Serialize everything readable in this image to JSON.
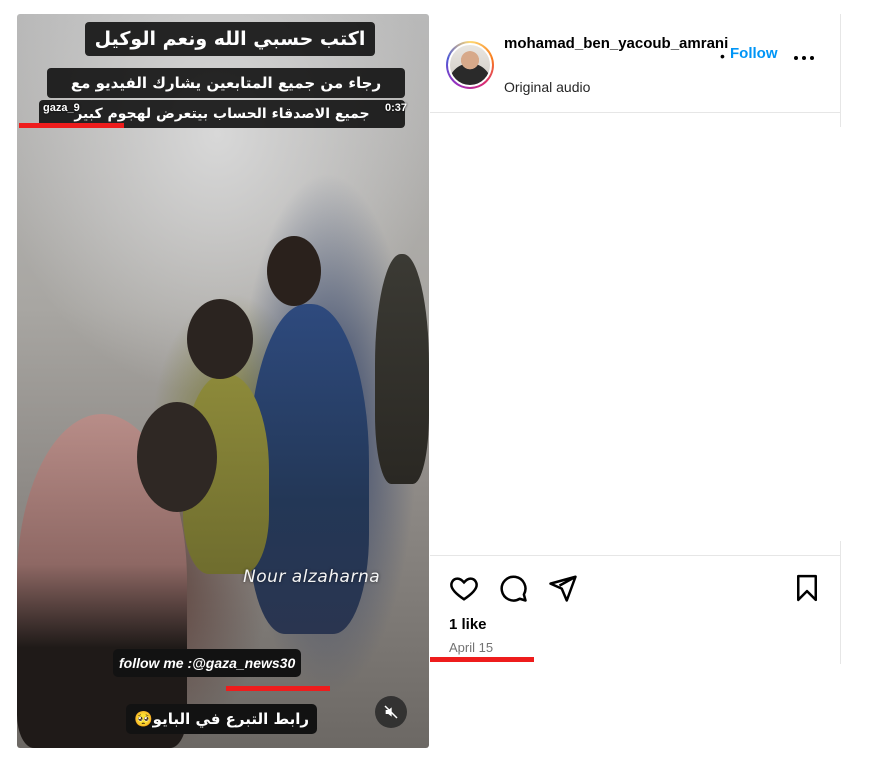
{
  "video": {
    "caption_top": "اكتب حسبي الله ونعم الوكيل",
    "caption_line2": "رجاء من جميع المتابعين يشارك الفيديو مع",
    "caption_line3": "جميع الاصدقاء الحساب بيتعرض لهجوم كبير",
    "overlay_handle": "gaza_9",
    "time_left": "0:37",
    "watermark": "Nour alzaharna",
    "follow_caption": "follow me :@gaza_news30",
    "donate_caption": "رابط التبرع في البايو🥺",
    "mute_icon": "speaker-muted-icon"
  },
  "post": {
    "username": "mohamad_ben_yacoub_amrani",
    "separator": "•",
    "follow_label": "Follow",
    "audio_label": "Original audio",
    "likes": "1 like",
    "date": "April 15"
  },
  "icons": {
    "like": "heart-icon",
    "comment": "comment-icon",
    "share": "paper-plane-icon",
    "save": "bookmark-icon",
    "more": "more-options-icon"
  },
  "colors": {
    "accent": "#0095f6",
    "annotation_red": "#ee1c1c",
    "muted_text": "#737373"
  }
}
